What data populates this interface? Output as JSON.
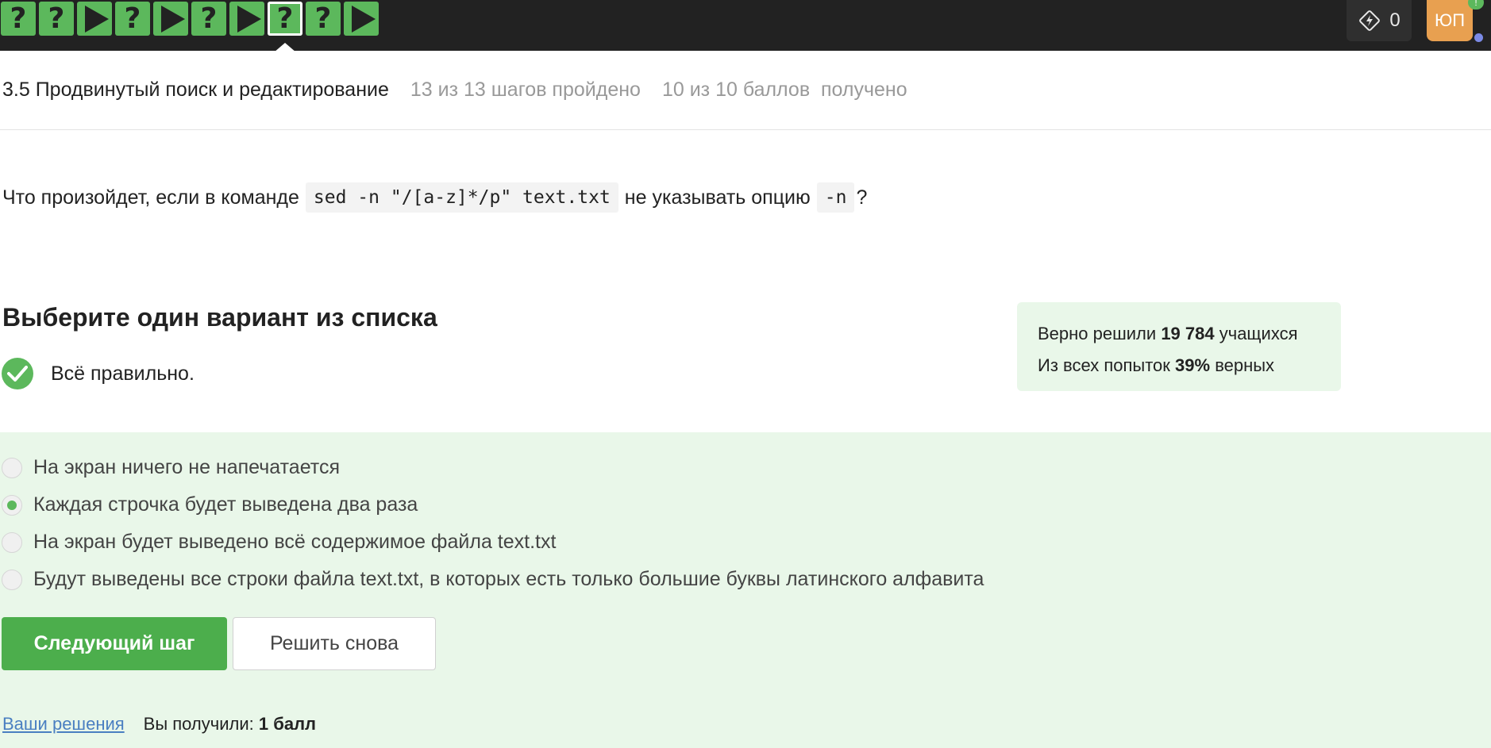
{
  "topbar": {
    "steps": [
      {
        "type": "question",
        "symbol": "?"
      },
      {
        "type": "question",
        "symbol": "?"
      },
      {
        "type": "video",
        "symbol": ""
      },
      {
        "type": "question",
        "symbol": "?"
      },
      {
        "type": "video",
        "symbol": ""
      },
      {
        "type": "question",
        "symbol": "?"
      },
      {
        "type": "video",
        "symbol": ""
      },
      {
        "type": "question",
        "symbol": "?",
        "current": true
      },
      {
        "type": "question",
        "symbol": "?"
      },
      {
        "type": "video",
        "symbol": ""
      }
    ],
    "energy_count": "0",
    "avatar_initials": "ЮП",
    "avatar_badge": "!",
    "colors": {
      "bar": "#222222",
      "step": "#5cb85c"
    }
  },
  "lesson": {
    "title": "3.5 Продвинутый поиск и редактирование",
    "steps_progress": "13 из 13 шагов пройдено",
    "points_progress": "10 из 10 баллов  получено"
  },
  "question": {
    "text_before": "Что произойдет, если в команде",
    "command": "sed -n \"/[a-z]*/p\" text.txt",
    "text_middle": "не указывать опцию",
    "option_code": "-n",
    "text_after": "?"
  },
  "choose_title": "Выберите один вариант из списка",
  "result": {
    "message": "Всё правильно."
  },
  "stats": {
    "line1_prefix": "Верно решили",
    "solved_count": "19 784",
    "line1_suffix": "учащихся",
    "line2_prefix": "Из всех попыток",
    "percent": "39%",
    "line2_suffix": "верных"
  },
  "options": [
    {
      "label": "На экран ничего не напечатается",
      "checked": false
    },
    {
      "label": "Каждая строчка будет выведена два раза",
      "checked": true
    },
    {
      "label": "На экран будет выведено всё содержимое файла text.txt",
      "checked": false
    },
    {
      "label": "Будут выведены все строки файла text.txt, в которых есть только большие буквы латинского алфавита",
      "checked": false
    }
  ],
  "buttons": {
    "next": "Следующий шаг",
    "again": "Решить снова"
  },
  "footer": {
    "solutions_link": "Ваши решения",
    "received_prefix": "Вы получили:",
    "received_value": "1 балл"
  }
}
